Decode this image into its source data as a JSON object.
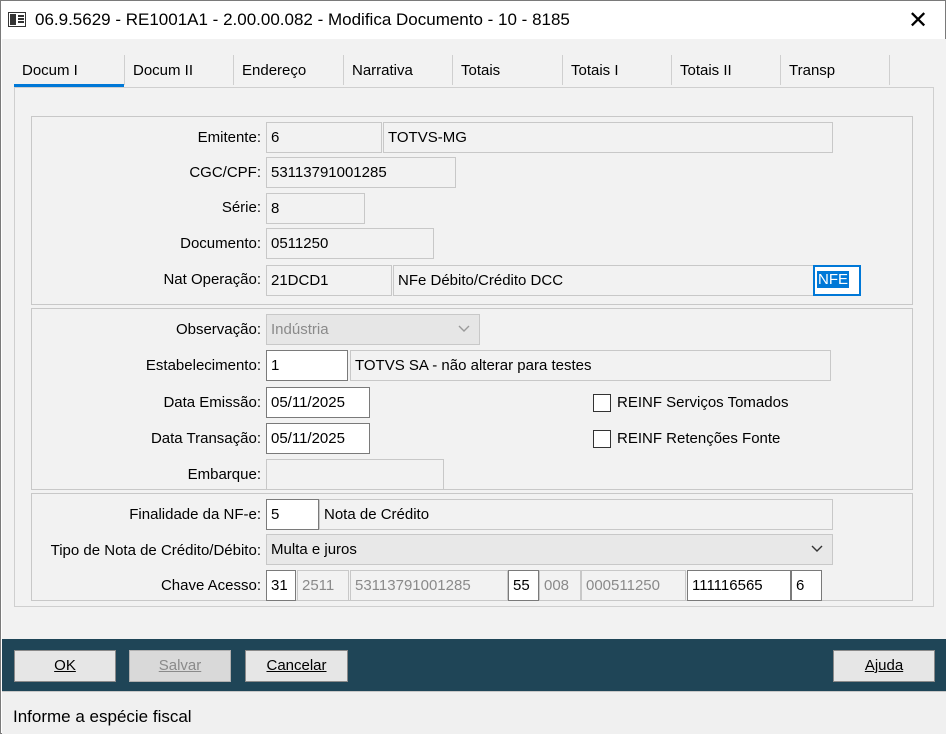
{
  "window": {
    "title": "06.9.5629 - RE1001A1 - 2.00.00.082 - Modifica Documento - 10 - 8185",
    "close_glyph": "✕"
  },
  "tabs": [
    {
      "label": "Docum I"
    },
    {
      "label": "Docum II"
    },
    {
      "label": "Endereço"
    },
    {
      "label": "Narrativa"
    },
    {
      "label": "Totais"
    },
    {
      "label": "Totais I"
    },
    {
      "label": "Totais II"
    },
    {
      "label": "Transp"
    }
  ],
  "accent_color": "#0078d7",
  "bottombar_color": "#1f4557",
  "form": {
    "emitente": {
      "label": "Emitente:",
      "code": "6",
      "name": "TOTVS-MG"
    },
    "cgc_cpf": {
      "label": "CGC/CPF:",
      "value": "53113791001285"
    },
    "serie": {
      "label": "Série:",
      "value": "8"
    },
    "documento": {
      "label": "Documento:",
      "value": "0511250"
    },
    "nat_operacao": {
      "label": "Nat Operação:",
      "code": "21DCD1",
      "description": "NFe Débito/Crédito DCC",
      "especie": "NFE"
    },
    "observacao": {
      "label": "Observação:",
      "value": "Indústria"
    },
    "estabelecimento": {
      "label": "Estabelecimento:",
      "code": "1",
      "name": "TOTVS SA - não alterar para testes"
    },
    "data_emissao": {
      "label": "Data Emissão:",
      "value": "05/11/2025"
    },
    "data_transacao": {
      "label": "Data Transação:",
      "value": "05/11/2025"
    },
    "embarque": {
      "label": "Embarque:",
      "value": ""
    },
    "reinf_servicos": {
      "label": "REINF Serviços Tomados",
      "checked": false
    },
    "reinf_retencoes": {
      "label": "REINF Retenções Fonte",
      "checked": false
    },
    "finalidade": {
      "label": "Finalidade da NF-e:",
      "code": "5",
      "description": "Nota de Crédito"
    },
    "tipo_nota": {
      "label": "Tipo de Nota de Crédito/Débito:",
      "value": "Multa e juros"
    },
    "chave_acesso": {
      "label": "Chave Acesso:",
      "uf": "31",
      "aamm": "2511",
      "cnpj": "53113791001285",
      "modelo": "55",
      "serie": "008",
      "numero": "000511250",
      "codigo": "111116565",
      "dv": "6"
    }
  },
  "buttons": {
    "ok": {
      "label": "OK"
    },
    "salvar": {
      "label": "Salvar"
    },
    "cancelar": {
      "label": "Cancelar"
    },
    "ajuda": {
      "label": "Ajuda"
    }
  },
  "status": {
    "message": "Informe a espécie fiscal"
  }
}
